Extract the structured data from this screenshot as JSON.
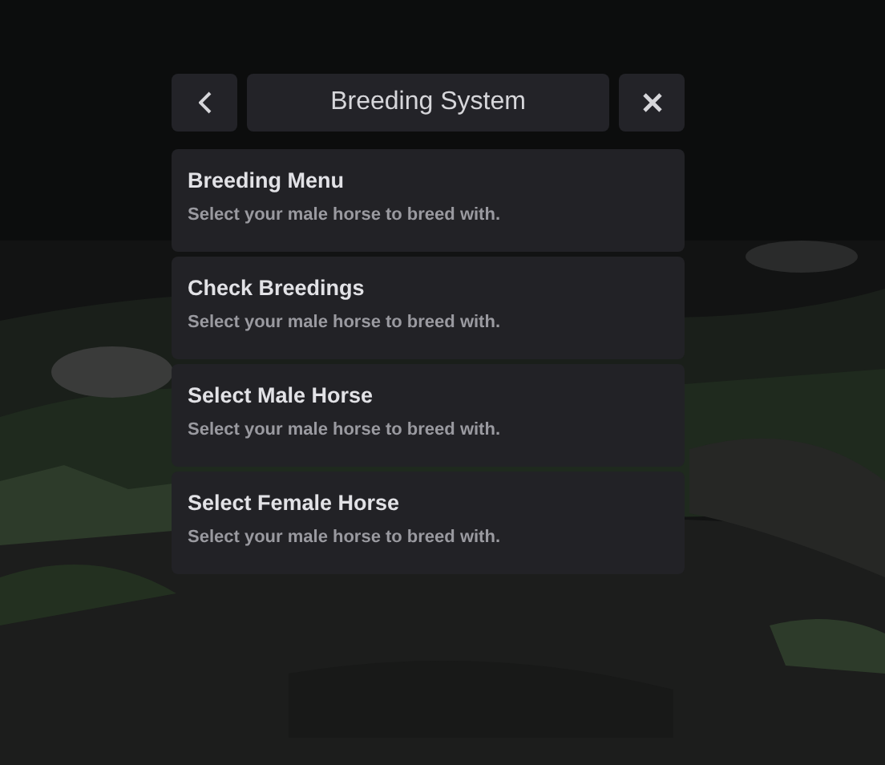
{
  "header": {
    "title": "Breeding System"
  },
  "menu_items": [
    {
      "title": "Breeding Menu",
      "description": "Select your male horse to breed with."
    },
    {
      "title": "Check Breedings",
      "description": "Select your male horse to breed with."
    },
    {
      "title": "Select Male Horse",
      "description": "Select your male horse to breed with."
    },
    {
      "title": "Select Female Horse",
      "description": "Select your male horse to breed with."
    }
  ]
}
